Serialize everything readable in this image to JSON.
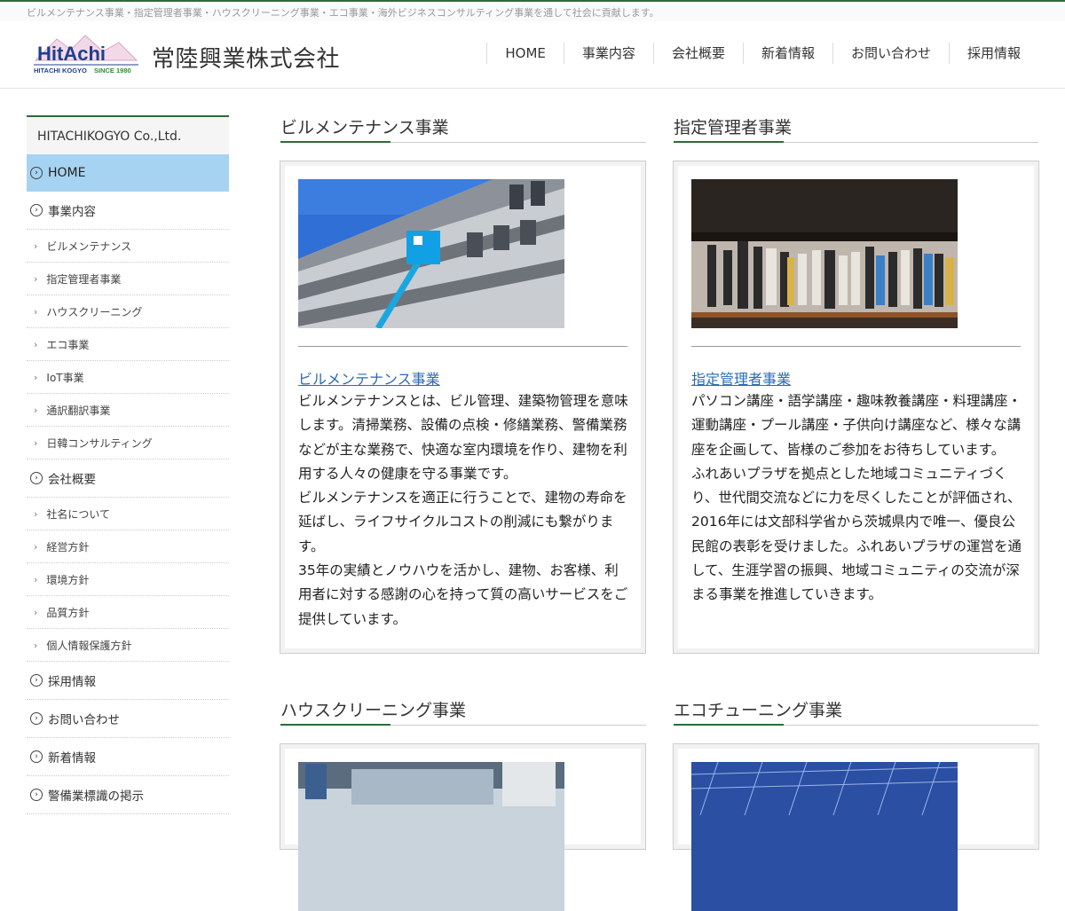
{
  "tagline": "ビルメンテナンス事業・指定管理者事業・ハウスクリーニング事業・エコ事業・海外ビジネスコンサルティング事業を通して社会に貢献します。",
  "logo": {
    "word": "HitAchi",
    "sub": "HITACHI KOGYO",
    "since": "SINCE 1980"
  },
  "company_name": "常陸興業株式会社",
  "gnav": [
    "HOME",
    "事業内容",
    "会社概要",
    "新着情報",
    "お問い合わせ",
    "採用情報"
  ],
  "sidebar": {
    "title": "HITACHIKOGYO Co.,Ltd.",
    "home": "HOME",
    "groups": [
      {
        "label": "事業内容",
        "subs": [
          "ビルメンテナンス",
          "指定管理者事業",
          "ハウスクリーニング",
          "エコ事業",
          "IoT事業",
          "通訳翻訳事業",
          "日韓コンサルティング"
        ]
      },
      {
        "label": "会社概要",
        "subs": [
          "社名について",
          "経営方針",
          "環境方針",
          "品質方針",
          "個人情報保護方針"
        ]
      }
    ],
    "tail": [
      "採用情報",
      "お問い合わせ",
      "新着情報",
      "警備業標識の掲示"
    ]
  },
  "sections": [
    {
      "title": "ビルメンテナンス事業",
      "link": "ビルメンテナンス事業",
      "paragraphs": [
        "ビルメンテナンスとは、ビル管理、建築物管理を意味します。清掃業務、設備の点検・修繕業務、警備業務などが主な業務で、快適な室内環境を作り、建物を利用する人々の健康を守る事業です。",
        "ビルメンテナンスを適正に行うことで、建物の寿命を延ばし、ライフサイクルコストの削減にも繋がります。",
        "35年の実績とノウハウを活かし、建物、お客様、利用者に対する感謝の心を持って質の高いサービスをご提供しています。"
      ]
    },
    {
      "title": "指定管理者事業",
      "link": "指定管理者事業",
      "paragraphs": [
        "パソコン講座・語学講座・趣味教養講座・料理講座・運動講座・プール講座・子供向け講座など、様々な講座を企画して、皆様のご参加をお待ちしています。",
        "ふれあいプラザを拠点とした地域コミュニティづくり、世代間交流などに力を尽くしたことが評価され、2016年には文部科学省から茨城県内で唯一、優良公民館の表彰を受けました。ふれあいプラザの運営を通して、生涯学習の振興、地域コミュニティの交流が深まる事業を推進していきます。"
      ]
    },
    {
      "title": "ハウスクリーニング事業"
    },
    {
      "title": "エコチューニング事業"
    }
  ],
  "colors": {
    "accent_green": "#2e6b3a",
    "home_highlight": "#a7d3f2",
    "link_blue": "#2a6bb6"
  }
}
